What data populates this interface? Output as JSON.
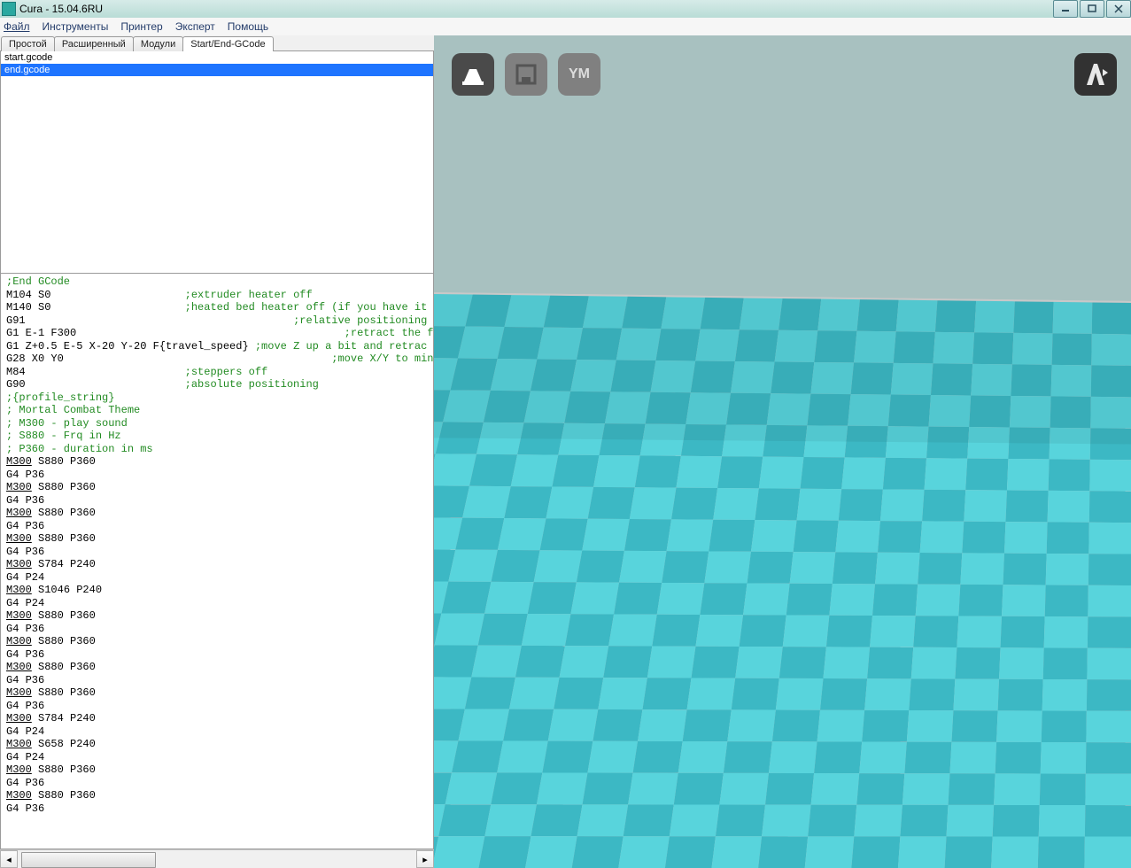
{
  "window": {
    "title": "Cura - 15.04.6RU"
  },
  "menu": {
    "file": "Файл",
    "tools": "Инструменты",
    "printer": "Принтер",
    "expert": "Эксперт",
    "help": "Помощь"
  },
  "tabs": {
    "simple": "Простой",
    "advanced": "Расширенный",
    "modules": "Модули",
    "gcode": "Start/End-GCode"
  },
  "files": {
    "start": "start.gcode",
    "end": "end.gcode"
  },
  "code": {
    "l1_a": ";End GCode",
    "l2_a": "M104 S0",
    "l2_b": ";extruder heater off",
    "l3_a": "M140 S0",
    "l3_b": ";heated bed heater off (if you have it",
    "l4_a": "G91",
    "l4_b": ";relative positioning",
    "l5_a": "G1 E-1 F300",
    "l5_b": ";retract the filament a bit",
    "l6_a": "G1 Z+0.5 E-5 X-20 Y-20 F{travel_speed}",
    "l6_b": ";move Z up a bit and retrac",
    "l7_a": "G28 X0 Y0",
    "l7_b": ";move X/Y to min endstops,",
    "l8_a": "M84",
    "l8_b": ";steppers off",
    "l9_a": "G90",
    "l9_b": ";absolute positioning",
    "l10_a": ";{profile_string}",
    "l11_a": "; Mortal Combat Theme",
    "l12_a": "; M300 - play sound",
    "l13_a": "; S880 - Frq in Hz",
    "l14_a": "; P360 - duration in ms",
    "m300": "M300",
    "b1": " S880 P360",
    "g36": "G4 P36",
    "b5": " S784 P240",
    "g24": "G4 P24",
    "b6": " S1046 P240",
    "b12": " S658 P240",
    "tb_ym": "YM"
  }
}
